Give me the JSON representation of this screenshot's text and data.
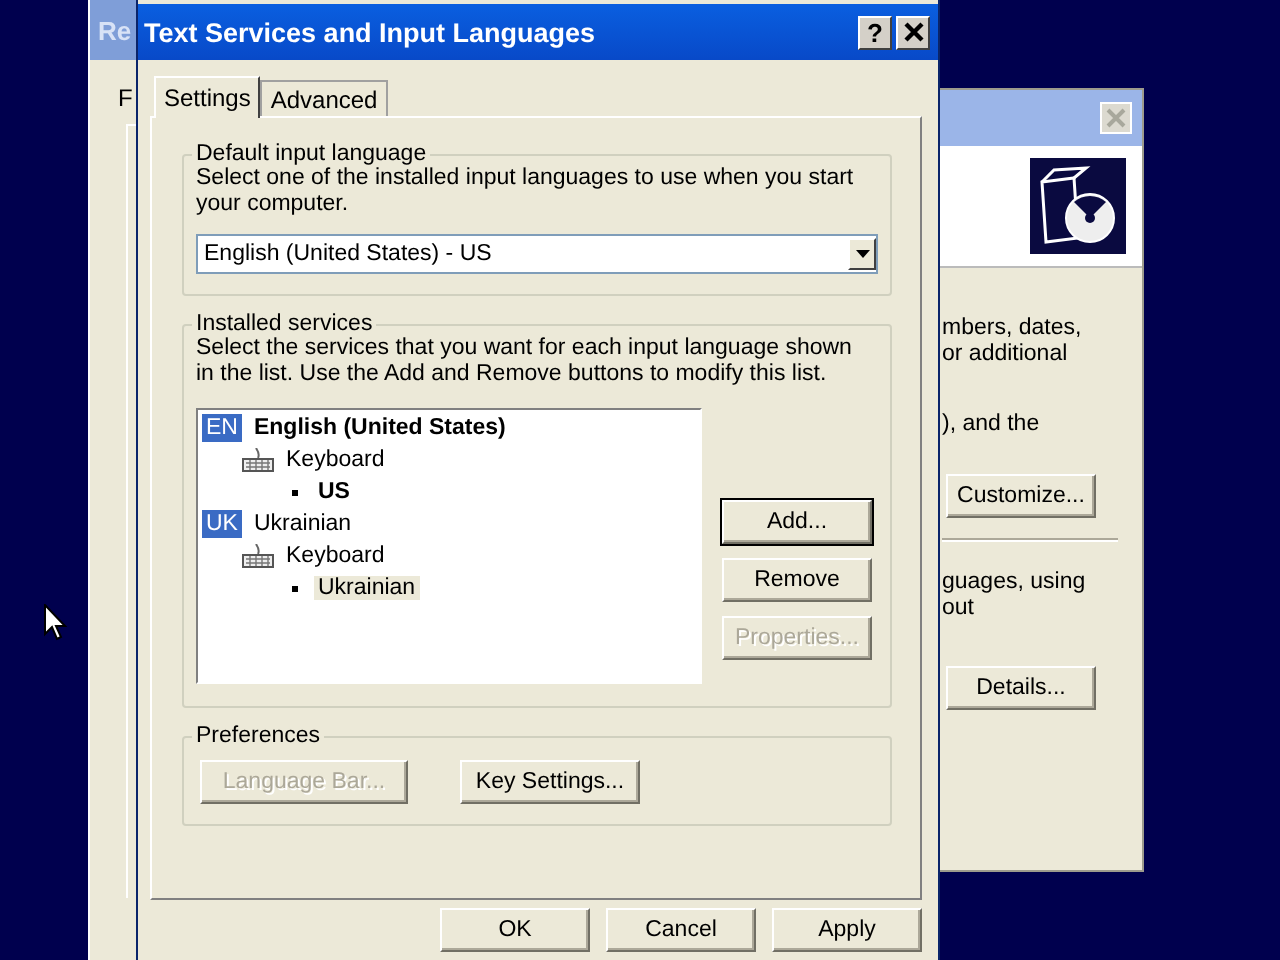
{
  "regional_window": {
    "title": "Re",
    "tab": "F"
  },
  "right_window": {
    "texts": [
      "mbers, dates,",
      "or additional",
      "), and the"
    ],
    "button_1": "Customize...",
    "texts_2": [
      "guages, using",
      "out"
    ],
    "button_2": "Details..."
  },
  "dialog": {
    "title": "Text Services and Input Languages",
    "help": "?",
    "tabs": [
      {
        "label": "Settings",
        "selected": true
      },
      {
        "label": "Advanced",
        "selected": false
      }
    ],
    "default_input_language": {
      "legend": "Default input language",
      "description": "Select one of the installed input languages to use when you start your computer.",
      "dropdown": {
        "value": "English (United States) - US"
      }
    },
    "installed_services": {
      "legend": "Installed services",
      "description": "Select the services that you want for each input language shown in the list. Use the Add and Remove buttons to modify this list.",
      "tree": [
        {
          "badge": "EN",
          "label": "English (United States)",
          "default": true,
          "children": [
            {
              "kind": "keyboard",
              "label": "Keyboard",
              "children": [
                {
                  "kind": "layout",
                  "label": "US",
                  "default": true,
                  "selected": false
                }
              ]
            }
          ]
        },
        {
          "badge": "UK",
          "label": "Ukrainian",
          "default": false,
          "children": [
            {
              "kind": "keyboard",
              "label": "Keyboard",
              "children": [
                {
                  "kind": "layout",
                  "label": "Ukrainian",
                  "default": false,
                  "selected": true
                }
              ]
            }
          ]
        }
      ],
      "buttons": [
        {
          "label": "Add...",
          "disabled": false,
          "default": true
        },
        {
          "label": "Remove",
          "disabled": false,
          "default": false
        },
        {
          "label": "Properties...",
          "disabled": true,
          "default": false
        }
      ]
    },
    "preferences": {
      "legend": "Preferences",
      "buttons": [
        {
          "label": "Language Bar...",
          "disabled": true
        },
        {
          "label": "Key Settings...",
          "disabled": false
        }
      ]
    },
    "footer_buttons": [
      {
        "label": "OK",
        "disabled": false
      },
      {
        "label": "Cancel",
        "disabled": false
      },
      {
        "label": "Apply",
        "disabled": false
      }
    ]
  }
}
